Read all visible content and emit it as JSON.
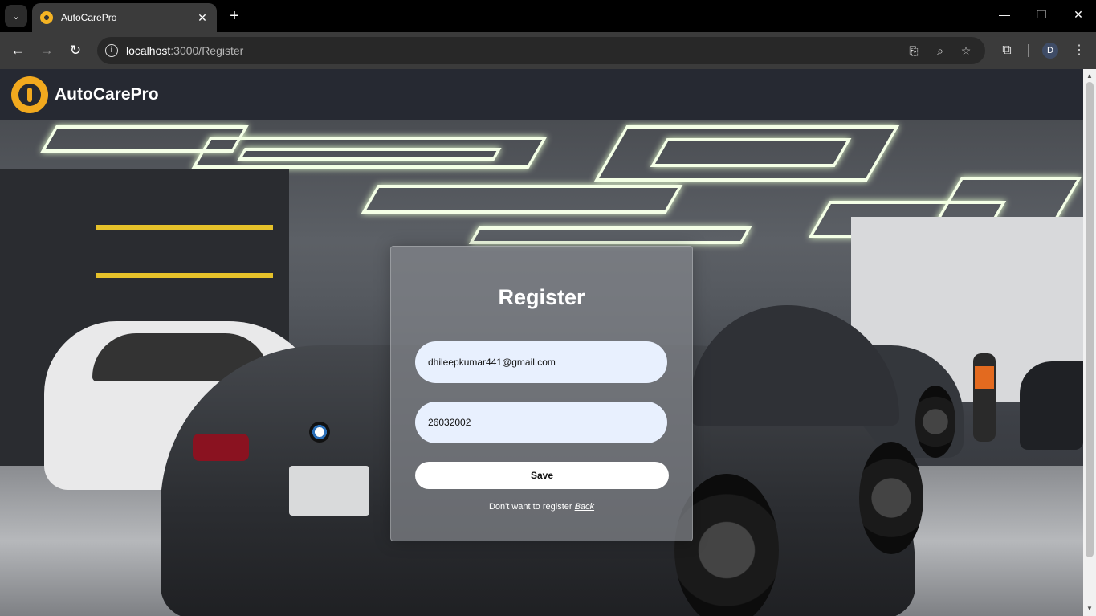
{
  "browser": {
    "tab_title": "AutoCarePro",
    "tab_close": "✕",
    "new_tab": "+",
    "url_host": "localhost",
    "url_rest": ":3000/Register",
    "avatar_letter": "D"
  },
  "header": {
    "brand": "AutoCarePro"
  },
  "register": {
    "title": "Register",
    "email_value": "dhileepkumar441@gmail.com",
    "password_value": "26032002",
    "save_label": "Save",
    "footer_text": "Don't want to register",
    "back_label": "Back"
  },
  "icons": {
    "tab_menu": "chevron-down-icon",
    "back": "arrow-left-icon",
    "forward": "arrow-right-icon",
    "reload": "reload-icon",
    "site_info": "info-icon",
    "install": "install-app-icon",
    "zoom": "zoom-icon",
    "bookmark": "star-icon",
    "extensions": "puzzle-icon",
    "menu": "kebab-menu-icon"
  },
  "colors": {
    "header_bg": "#262932",
    "logo_accent": "#f2a91e",
    "field_bg": "#e8f0fe",
    "card_bg": "rgba(130,133,138,0.72)"
  }
}
